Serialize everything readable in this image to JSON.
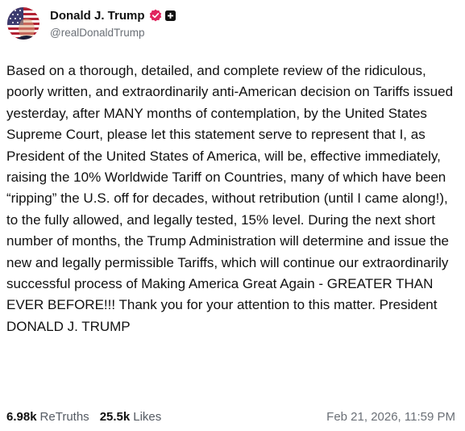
{
  "author": {
    "display_name": "Donald J. Trump",
    "handle": "@realDonaldTrump",
    "avatar_icon": "flag-avatar",
    "verified_icon": "verified-badge-icon",
    "badge_icon": "plus-badge-icon",
    "verified_color": "#e0245e"
  },
  "post": {
    "text": "Based on a thorough, detailed, and complete review of the ridiculous, poorly written, and extraordinarily anti-American decision on Tariffs issued yesterday, after MANY months of contemplation, by the United States Supreme Court, please let this statement serve to represent that I, as President of the United States of America, will be, effective immediately, raising the 10% Worldwide Tariff on Countries, many of which have been “ripping” the U.S. off for decades, without retribution (until I came along!), to the fully allowed, and legally tested, 15% level. During the next short number of months, the Trump Administration will determine and issue the new and legally permissible Tariffs, which will continue our extraordinarily successful process of Making America Great Again - GREATER THAN EVER BEFORE!!! Thank you for your attention to this matter. President DONALD J. TRUMP"
  },
  "stats": {
    "retruths_count": "6.98k",
    "retruths_label": "ReTruths",
    "likes_count": "25.5k",
    "likes_label": "Likes"
  },
  "timestamp": "Feb 21, 2026, 11:59 PM"
}
